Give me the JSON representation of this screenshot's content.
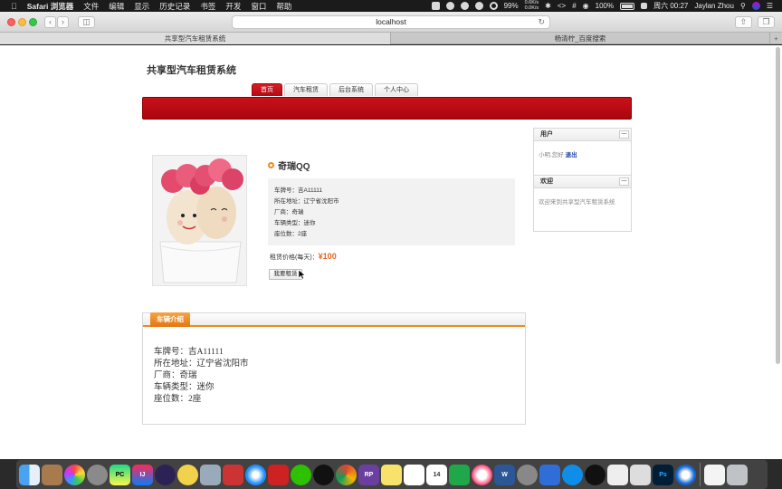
{
  "menubar": {
    "apple": "",
    "app_name": "Safari 浏览器",
    "menus": [
      "文件",
      "编辑",
      "显示",
      "历史记录",
      "书签",
      "开发",
      "窗口",
      "帮助"
    ],
    "net_up": "0.6K/s",
    "net_down": "0.0K/s",
    "battery": "99%",
    "brightness": "100%",
    "time": "周六 00:27",
    "user": "Jaylan Zhou"
  },
  "browser": {
    "address": "localhost",
    "tabs": [
      "共享型汽车租赁系统",
      "杨清柠_百度搜索"
    ],
    "new_tab": "+"
  },
  "site": {
    "title": "共享型汽车租赁系统",
    "nav": [
      "首页",
      "汽车租赁",
      "后台系统",
      "个人中心"
    ],
    "active_nav": "首页"
  },
  "car": {
    "name": "奇瑞QQ",
    "details": [
      "车牌号：吉A11111",
      "所在地址：辽宁省沈阳市",
      "厂商：奇瑞",
      "车辆类型：迷你",
      "座位数：2座"
    ],
    "price_label": "租赁价格(每天)：",
    "price_value": "¥100",
    "rent_button": "我要租赁"
  },
  "sidebar": {
    "user_title": "用户",
    "user_greeting": "小明,您好",
    "logout": "退出",
    "welcome_title": "欢迎",
    "welcome_text": "欢迎来到共享型汽车租赁系统",
    "more": "—"
  },
  "intro": {
    "tab": "车辆介绍",
    "lines": [
      "车牌号：吉A11111",
      "所在地址：辽宁省沈阳市",
      "厂商：奇瑞",
      "车辆类型：迷你",
      "座位数：2座"
    ]
  },
  "dock": {
    "apps": [
      "finder-icon",
      "launchpad-icon",
      "photos-icon",
      "rocket-icon",
      "pycharm-icon",
      "intellij-icon",
      "eclipse-icon",
      "melon-icon",
      "disk-icon",
      "books-icon",
      "safari-icon",
      "photo-booth-icon",
      "wechat-icon",
      "qq-icon",
      "chrome-icon",
      "rp-icon",
      "notes-icon",
      "reminders-icon",
      "calendar-icon",
      "numbers-icon",
      "music-icon",
      "word-icon",
      "preferences-icon",
      "baidu-icon",
      "teamviewer-icon",
      "qq2-icon",
      "textedit-icon",
      "stickies-icon",
      "photoshop-icon",
      "edge-icon",
      "document-icon",
      "trash-icon"
    ],
    "pycharm": "PC",
    "intellij": "IJ",
    "rp": "RP",
    "photoshop": "Ps",
    "calendar_day": "14",
    "word": "W"
  }
}
